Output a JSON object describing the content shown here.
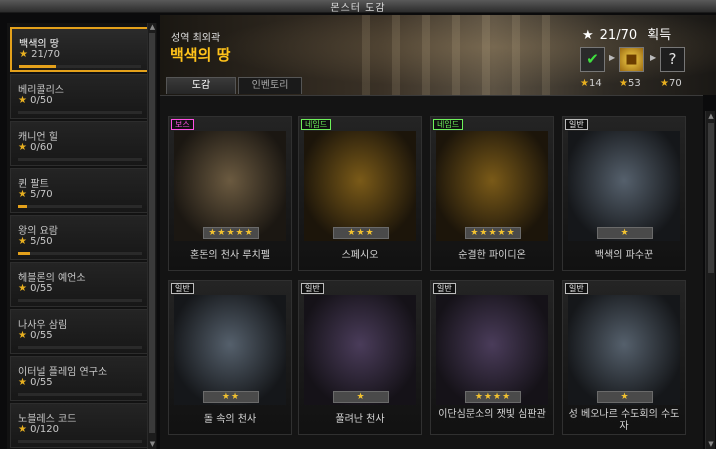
{
  "window": {
    "title": "몬스터 도감"
  },
  "sidebar": {
    "items": [
      {
        "name": "백색의 땅",
        "count": "21/70",
        "progress": 0.3,
        "active": true
      },
      {
        "name": "베리콜리스",
        "count": "0/50",
        "progress": 0
      },
      {
        "name": "캐니언 힐",
        "count": "0/60",
        "progress": 0
      },
      {
        "name": "퀸 팔트",
        "count": "5/70",
        "progress": 0.07
      },
      {
        "name": "왕의 요람",
        "count": "5/50",
        "progress": 0.1
      },
      {
        "name": "헤블론의 예언소",
        "count": "0/55",
        "progress": 0
      },
      {
        "name": "나사우 삼림",
        "count": "0/55",
        "progress": 0
      },
      {
        "name": "이터널 플레임 연구소",
        "count": "0/55",
        "progress": 0
      },
      {
        "name": "노블레스 코드",
        "count": "0/120",
        "progress": 0
      }
    ],
    "star_glyph": "★"
  },
  "header": {
    "subtitle": "성역 최외곽",
    "title": "백색의 땅",
    "collect_count": "21/70",
    "collect_label": "획득",
    "rewards": [
      {
        "icon": "checkmark-icon",
        "label": "14"
      },
      {
        "icon": "gold-chest-icon",
        "label": "53"
      },
      {
        "icon": "question-mark-icon",
        "label": "70"
      }
    ]
  },
  "tabs": [
    {
      "label": "도감",
      "active": true
    },
    {
      "label": "인벤토리",
      "active": false
    }
  ],
  "cards": [
    {
      "badge": "보스",
      "badge_type": "boss",
      "stars": 5,
      "name": "혼돈의 천사 루치펠",
      "art": "boss"
    },
    {
      "badge": "네임드",
      "badge_type": "named",
      "stars": 3,
      "name": "스페시오",
      "art": "gold"
    },
    {
      "badge": "네임드",
      "badge_type": "named",
      "stars": 5,
      "name": "순결한 파이디온",
      "art": "gold"
    },
    {
      "badge": "일반",
      "badge_type": "normal",
      "stars": 1,
      "name": "백색의 파수꾼",
      "art": "blue"
    },
    {
      "badge": "일반",
      "badge_type": "normal",
      "stars": 2,
      "name": "돌 속의 천사",
      "art": "blue"
    },
    {
      "badge": "일반",
      "badge_type": "normal",
      "stars": 1,
      "name": "풀려난 천사",
      "art": "violet"
    },
    {
      "badge": "일반",
      "badge_type": "normal",
      "stars": 4,
      "name": "이단심문소의 잿빛 심판관",
      "art": "violet"
    },
    {
      "badge": "일반",
      "badge_type": "normal",
      "stars": 1,
      "name": "성 베오나르 수도회의 수도자",
      "art": "blue"
    }
  ],
  "colors": {
    "accent": "#e4a11b",
    "title": "#ffc21a",
    "boss": "#ff4fe3",
    "named": "#6df05a"
  }
}
